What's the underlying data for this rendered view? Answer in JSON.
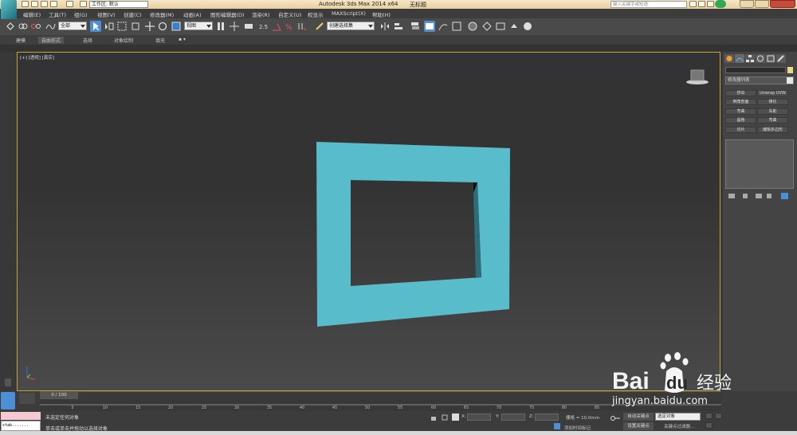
{
  "titlebar": {
    "app_title": "Autodesk 3ds Max  2014 x64",
    "file_name": "无标题",
    "workspace_label": "工作区: 默认",
    "search_placeholder": "键入关键字或短语"
  },
  "menu": [
    "编辑(E)",
    "工具(T)",
    "组(G)",
    "视图(V)",
    "创建(C)",
    "修改器(M)",
    "动画(A)",
    "图形编辑器(D)",
    "渲染(R)",
    "自定义(U)",
    "MAXScript(X)",
    "帮助(H)"
  ],
  "toolbar": {
    "selection_filter": "全部",
    "reference_coord": "视图",
    "named_selection": "创建选择集"
  },
  "ribbon": {
    "tabs": [
      "建模",
      "自由形式",
      "选择",
      "对象绘制",
      "填充"
    ]
  },
  "viewport": {
    "label": "[+] [透视] [真实]",
    "object_color": "#5bbfcc"
  },
  "command_panel": {
    "modifier_list": "修改器列表",
    "buttons": [
      "挤出",
      "Unwrap UVW",
      "倒角剖面",
      "锥化",
      "弯曲",
      "车削",
      "晶格",
      "弯曲",
      "切片",
      "编辑多边形"
    ]
  },
  "timeline": {
    "frame_display": "0 / 100",
    "ticks": [
      "5",
      "10",
      "15",
      "20",
      "25",
      "30",
      "35",
      "40",
      "45",
      "50",
      "55",
      "60",
      "65",
      "70",
      "75",
      "80",
      "85"
    ]
  },
  "status": {
    "line1": "未选定任何对象",
    "line2": "单击或单击并拖动以选择对象",
    "x_label": "X:",
    "y_label": "Y:",
    "z_label": "Z:",
    "grid": "栅格 = 10.0mm",
    "auto_key": "自动关键点",
    "selection_set": "选定对象",
    "set_key": "设置关键点",
    "key_filter": "关键点过滤器...",
    "add_time_tag": "添加时间标记",
    "script_text": "stab......."
  },
  "watermark": {
    "brand": "Bai du 经验",
    "url": "jingyan.baidu.com"
  }
}
